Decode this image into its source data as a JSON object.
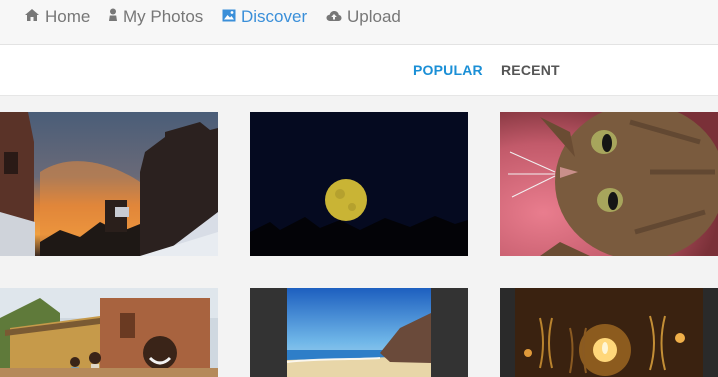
{
  "nav": {
    "home": "Home",
    "my_photos": "My Photos",
    "discover": "Discover",
    "upload": "Upload"
  },
  "tabs": {
    "popular": "POPULAR",
    "recent": "RECENT"
  },
  "colors": {
    "accent": "#1b8fd6",
    "nav_text": "#777777",
    "nav_active": "#3a8fd9"
  },
  "photos": [
    {
      "name": "sunset-rooftops-photo"
    },
    {
      "name": "full-moon-photo"
    },
    {
      "name": "cat-photo"
    },
    {
      "name": "village-children-photo"
    },
    {
      "name": "beach-photo"
    },
    {
      "name": "candlelight-dinner-photo"
    }
  ]
}
